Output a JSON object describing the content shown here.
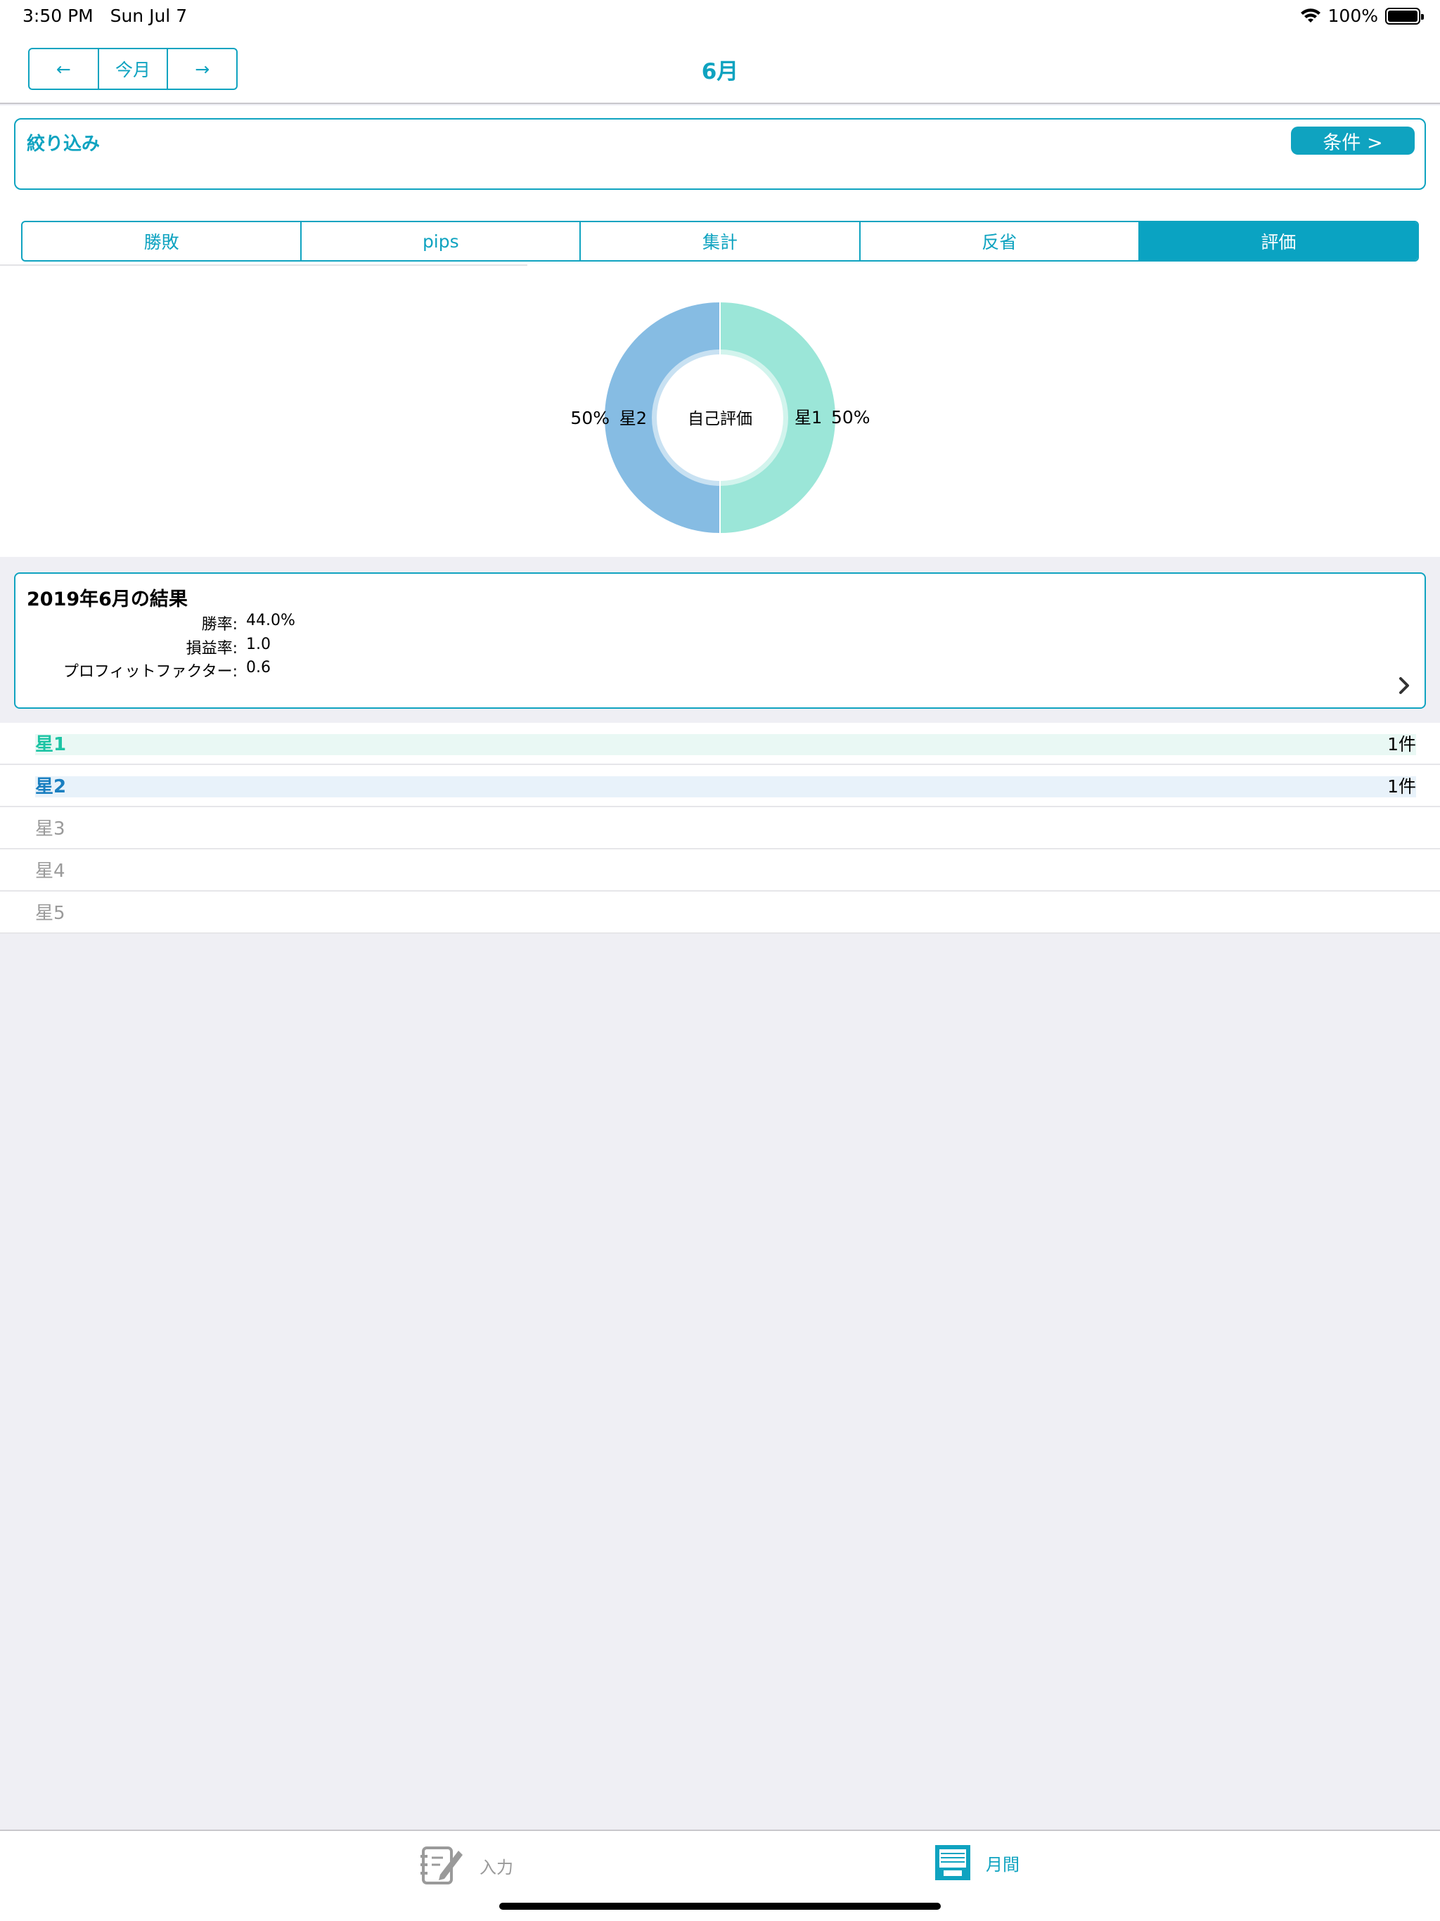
{
  "status_bar": {
    "time": "3:50 PM",
    "date": "Sun Jul 7",
    "battery": "100%"
  },
  "nav": {
    "prev": "←",
    "current": "今月",
    "next": "→",
    "title": "6月"
  },
  "filter": {
    "label": "絞り込み",
    "button": "条件 >"
  },
  "tabs": [
    {
      "label": "勝敗",
      "active": false
    },
    {
      "label": "pips",
      "active": false
    },
    {
      "label": "集計",
      "active": false
    },
    {
      "label": "反省",
      "active": false
    },
    {
      "label": "評価",
      "active": true
    }
  ],
  "chart_data": {
    "type": "pie",
    "title": "",
    "center_label": "自己評価",
    "slices": [
      {
        "label": "星1",
        "value": 50,
        "pct_label": "50%",
        "color": "#9be6d8"
      },
      {
        "label": "星2",
        "value": 50,
        "pct_label": "50%",
        "color": "#86bce3"
      }
    ]
  },
  "summary": {
    "title": "2019年6月の結果",
    "rows": [
      {
        "label": "勝率:",
        "value": "44.0%"
      },
      {
        "label": "損益率:",
        "value": "1.0"
      },
      {
        "label": "プロフィットファクター:",
        "value": "0.6"
      }
    ]
  },
  "ratings": [
    {
      "name": "星1",
      "count": "1件",
      "color": "#1cc4a4",
      "bg": "#e9f8f4"
    },
    {
      "name": "星2",
      "count": "1件",
      "color": "#1a7fc0",
      "bg": "#e8f2fa"
    },
    {
      "name": "星3",
      "count": "",
      "color": "#9a9a9a",
      "bg": ""
    },
    {
      "name": "星4",
      "count": "",
      "color": "#9a9a9a",
      "bg": ""
    },
    {
      "name": "星5",
      "count": "",
      "color": "#9a9a9a",
      "bg": ""
    }
  ],
  "tabbar": {
    "input_label": "入力",
    "monthly_label": "月間",
    "accent": "#0fa3c0"
  }
}
